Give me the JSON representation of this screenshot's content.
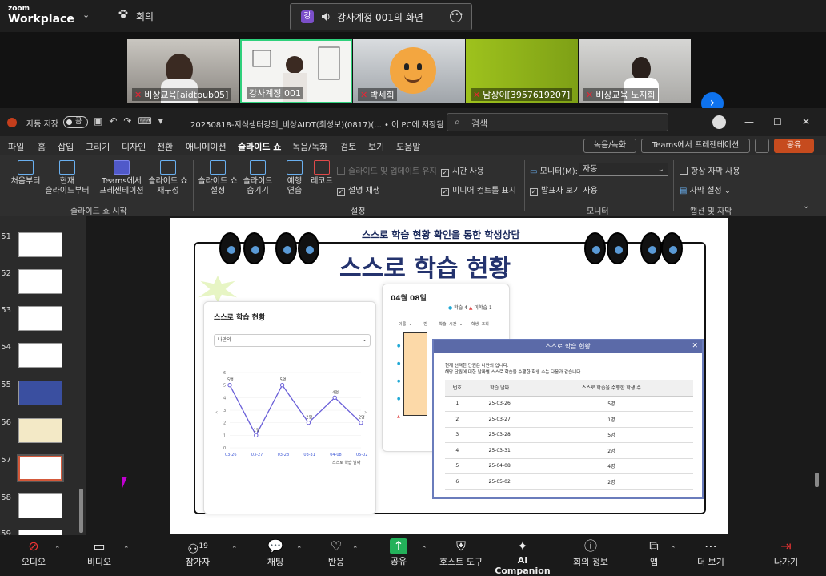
{
  "zoom": {
    "brand_small": "zoom",
    "brand_big": "Workplace",
    "meeting_label": "회의",
    "share_badge": "강",
    "share_title": "강사계정 001의 화면"
  },
  "participants": [
    {
      "name": "비상교육[aidtpub05]",
      "muted": true
    },
    {
      "name": "강사계정 001",
      "muted": false
    },
    {
      "name": "박세희",
      "muted": true
    },
    {
      "name": "남상이[3957619207]",
      "muted": true
    },
    {
      "name": "비상교육 노지희",
      "muted": true
    }
  ],
  "ppt": {
    "autosave": "자동 저장",
    "toggle": "끔",
    "filename": "20250818-지식샘터강의_비상AIDT(최성보)(0817)(... • 이 PC에 저장됨",
    "search_placeholder": "검색",
    "menu": [
      "파일",
      "홈",
      "삽입",
      "그리기",
      "디자인",
      "전환",
      "애니메이션",
      "슬라이드 쇼",
      "녹음/녹화",
      "검토",
      "보기",
      "도움말"
    ],
    "active_menu": "슬라이드 쇼",
    "rec_button": "녹음/녹화",
    "teams_button": "Teams에서 프레젠테이션",
    "share_button": "공유",
    "ribbon": {
      "from_start": "처음부터",
      "from_current": "현재\n슬라이드부터",
      "teams_present": "Teams에서\n프레젠테이션",
      "custom_show": "슬라이드 쇼\n재구성",
      "setup": "슬라이드 쇼\n설정",
      "hide": "슬라이드\n숨기기",
      "rehearse": "예행\n연습",
      "record": "레코드",
      "group_start": "슬라이드 쇼 시작",
      "group_setup": "설정",
      "group_monitor": "모니터",
      "group_caption": "캡션 및 자막",
      "keep_updated": "슬라이드 및 업데이트 유지",
      "use_timing": "시간 사용",
      "play_narration": "설명 재생",
      "show_media": "미디어 컨트롤 표시",
      "monitor_label": "모니터(M):",
      "monitor_value": "자동",
      "presenter_view": "발표자 보기 사용",
      "always_subtitle": "항상 자막 사용",
      "subtitle_settings": "자막 설정"
    },
    "slides": [
      "51",
      "52",
      "53",
      "54",
      "55",
      "56",
      "57",
      "58",
      "59"
    ],
    "selected_slide": "57"
  },
  "slide": {
    "subtitle": "스스로 학습 현황 확인을 통한 학생상담",
    "title": "스스로 학습 현황",
    "panel_title": "스스로 학습 현황",
    "dropdown": "나만의",
    "chart_xlabel": "스스로 학습 날짜",
    "date": "04월 08일",
    "legend_study": "학습 4",
    "legend_nostudy": "미학습 1",
    "cols": [
      "이름",
      "반",
      "학습 시간",
      "학생 조회"
    ],
    "modal_title": "스스로 학습 현황",
    "modal_desc1": "현재 선택한 단원은 나만의 입니다.",
    "modal_desc2": "해당 단원에 대한 날짜별 스스로 학습을 수행한 학생 수는 다음과 같습니다.",
    "table_headers": [
      "번호",
      "학습 날짜",
      "스스로 학습을 수행한 학생 수"
    ],
    "table_rows": [
      [
        "1",
        "25-03-26",
        "5명"
      ],
      [
        "2",
        "25-03-27",
        "1명"
      ],
      [
        "3",
        "25-03-28",
        "5명"
      ],
      [
        "4",
        "25-03-31",
        "2명"
      ],
      [
        "5",
        "25-04-08",
        "4명"
      ],
      [
        "6",
        "25-05-02",
        "2명"
      ]
    ]
  },
  "chart_data": {
    "type": "line",
    "categories": [
      "03-26",
      "03-27",
      "03-28",
      "03-31",
      "04-08",
      "05-02"
    ],
    "values": [
      5,
      1,
      5,
      2,
      4,
      2
    ],
    "ylim": [
      0,
      6
    ],
    "xlabel": "스스로 학습 날짜",
    "ylabel": "",
    "series_color": "#6a5fd8"
  },
  "taskbar": [
    "오디오",
    "비디오",
    "참가자",
    "채팅",
    "반응",
    "공유",
    "호스트 도구",
    "AI Companion",
    "회의 정보",
    "앱",
    "더 보기",
    "나가기"
  ],
  "participants_count": "19"
}
